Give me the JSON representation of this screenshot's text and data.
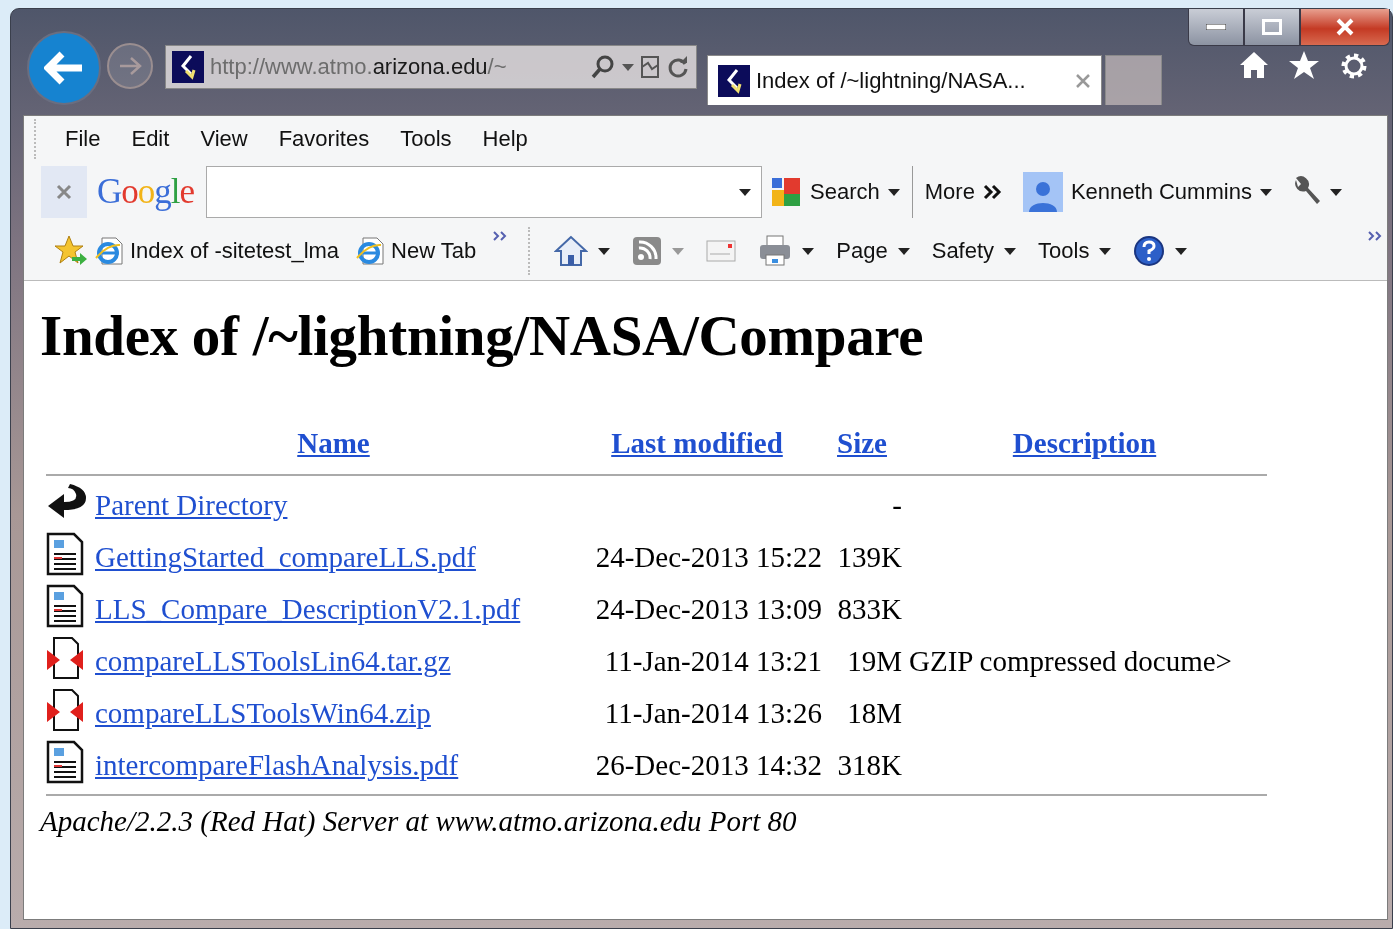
{
  "address_bar": {
    "url_parts": [
      {
        "text": "http://www.atmo.",
        "highlighted": false
      },
      {
        "text": "arizona.edu",
        "highlighted": true
      },
      {
        "text": "/~",
        "highlighted": false
      }
    ]
  },
  "tabs": [
    {
      "title": "Index of /~lightning/NASA...",
      "selected": true
    }
  ],
  "menu": [
    "File",
    "Edit",
    "View",
    "Favorites",
    "Tools",
    "Help"
  ],
  "google_toolbar": {
    "logo": "Google",
    "search_label": "Search",
    "more_label": "More",
    "account_name": "Kenneth Cummins"
  },
  "favorites_bar": [
    {
      "label": "Index of -sitetest_lma"
    },
    {
      "label": "New Tab"
    }
  ],
  "command_bar": [
    {
      "kind": "home"
    },
    {
      "kind": "feeds"
    },
    {
      "kind": "mail"
    },
    {
      "kind": "print"
    },
    {
      "kind": "menu",
      "label": "Page"
    },
    {
      "kind": "menu",
      "label": "Safety"
    },
    {
      "kind": "menu",
      "label": "Tools"
    },
    {
      "kind": "help"
    }
  ],
  "page": {
    "title": "Index of /~lightning/NASA/Compare",
    "columns": [
      "Name",
      "Last modified",
      "Size",
      "Description"
    ],
    "rows": [
      {
        "kind": "parent",
        "name": "Parent Directory",
        "size": "-"
      },
      {
        "kind": "document",
        "name": "GettingStarted_compareLLS.pdf",
        "modified": "24-Dec-2013 15:22",
        "size": "139K"
      },
      {
        "kind": "document",
        "name": "LLS_Compare_DescriptionV2.1.pdf",
        "modified": "24-Dec-2013 13:09",
        "size": "833K"
      },
      {
        "kind": "archive",
        "name": "compareLLSToolsLin64.tar.gz",
        "modified": "11-Jan-2014 13:21",
        "size": "19M",
        "description": "GZIP compressed docume>"
      },
      {
        "kind": "archive",
        "name": "compareLLSToolsWin64.zip",
        "modified": "11-Jan-2014 13:26",
        "size": "18M"
      },
      {
        "kind": "document",
        "name": "intercompareFlashAnalysis.pdf",
        "modified": "26-Dec-2013 14:32",
        "size": "318K"
      }
    ],
    "footer": "Apache/2.2.3 (Red Hat) Server at www.atmo.arizona.edu Port 80"
  }
}
